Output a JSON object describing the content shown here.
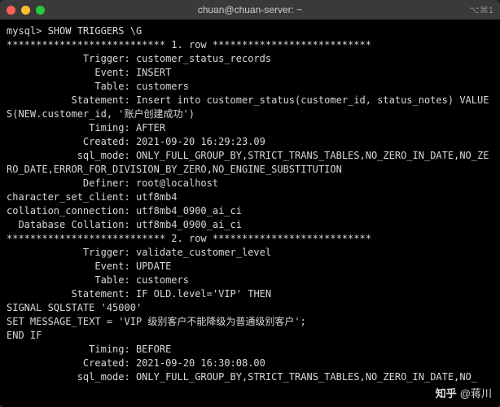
{
  "titlebar": {
    "title": "chuan@chuan-server: ~",
    "right_indicator": "⌥⌘1"
  },
  "prompt": "mysql> ",
  "command": "SHOW TRIGGERS \\G",
  "sep_row1": "*************************** 1. row ***************************",
  "sep_row2": "*************************** 2. row ***************************",
  "row1": {
    "trigger_label": "             Trigger:",
    "trigger_value": " customer_status_records",
    "event_label": "               Event:",
    "event_value": " INSERT",
    "table_label": "               Table:",
    "table_value": " customers",
    "statement_label": "           Statement:",
    "statement_value": " Insert into customer_status(customer_id, status_notes) VALUES(NEW.customer_id, '账户创建成功')",
    "timing_label": "              Timing:",
    "timing_value": " AFTER",
    "created_label": "             Created:",
    "created_value": " 2021-09-20 16:29:23.09",
    "sqlmode_label": "            sql_mode:",
    "sqlmode_value": " ONLY_FULL_GROUP_BY,STRICT_TRANS_TABLES,NO_ZERO_IN_DATE,NO_ZERO_DATE,ERROR_FOR_DIVISION_BY_ZERO,NO_ENGINE_SUBSTITUTION",
    "definer_label": "             Definer:",
    "definer_value": " root@localhost",
    "charset_label": "character_set_client:",
    "charset_value": " utf8mb4",
    "collconn_label": "collation_connection:",
    "collconn_value": " utf8mb4_0900_ai_ci",
    "dbcoll_label": "  Database Collation:",
    "dbcoll_value": " utf8mb4_0900_ai_ci"
  },
  "row2": {
    "trigger_label": "             Trigger:",
    "trigger_value": " validate_customer_level",
    "event_label": "               Event:",
    "event_value": " UPDATE",
    "table_label": "               Table:",
    "table_value": " customers",
    "statement_label": "           Statement:",
    "statement_value": " IF OLD.level='VIP' THEN",
    "stmt_line2": "SIGNAL SQLSTATE '45000'",
    "stmt_line3": "SET MESSAGE_TEXT = 'VIP 级别客户不能降级为普通级别客户';",
    "stmt_line4": "END IF",
    "timing_label": "              Timing:",
    "timing_value": " BEFORE",
    "created_label": "             Created:",
    "created_value": " 2021-09-20 16:30:08.00",
    "sqlmode_label": "            sql_mode:",
    "sqlmode_value": " ONLY_FULL_GROUP_BY,STRICT_TRANS_TABLES,NO_ZERO_IN_DATE,NO_"
  },
  "watermark": {
    "logo": "知乎",
    "user": "@蒋川"
  }
}
